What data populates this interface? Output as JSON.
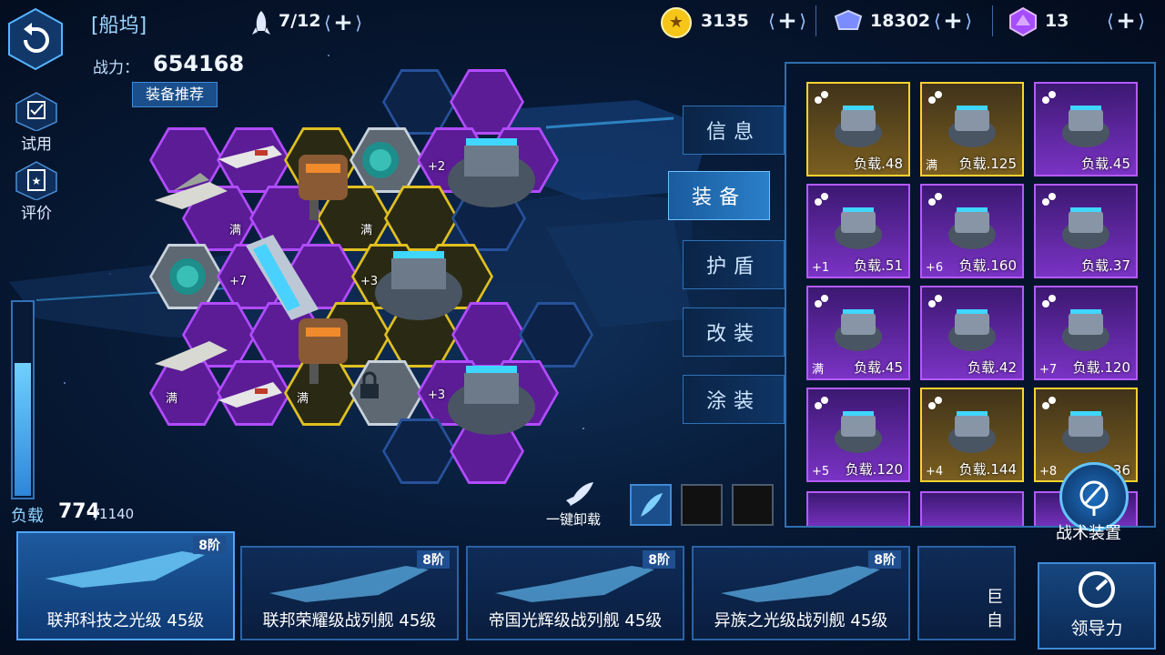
{
  "header": {
    "title": "[船坞]",
    "fleet_count": "7/12"
  },
  "resources": [
    {
      "name": "gold-coin-icon",
      "value": "3135",
      "color": "#f5c518"
    },
    {
      "name": "crystal-icon",
      "value": "18302",
      "color": "#6f82ff"
    },
    {
      "name": "gem-icon",
      "value": "13",
      "color": "#a64dff"
    }
  ],
  "power": {
    "label": "战力：",
    "value": "654168"
  },
  "recommend_button": "装备推荐",
  "side_buttons": {
    "trial": "试用",
    "review": "评价"
  },
  "load": {
    "label": "负载",
    "current": "774",
    "max": "/1140",
    "fraction": 0.68
  },
  "hex_labels": {
    "full1": "满",
    "full2": "满",
    "full3": "满",
    "full4": "满",
    "plus2": "+2",
    "plus3a": "+3",
    "plus7": "+7",
    "plus3b": "+3"
  },
  "tabs": [
    "信息",
    "装备",
    "护盾",
    "改装",
    "涂装"
  ],
  "active_tab": "装备",
  "inventory": [
    {
      "rarity": "y",
      "load": "负载.48",
      "tag": ""
    },
    {
      "rarity": "y",
      "load": "负载.125",
      "tag": "满"
    },
    {
      "rarity": "p",
      "load": "负载.45",
      "tag": ""
    },
    {
      "rarity": "p",
      "load": "负载.51",
      "tag": "+1"
    },
    {
      "rarity": "p",
      "load": "负载.160",
      "tag": "+6"
    },
    {
      "rarity": "p",
      "load": "负载.37",
      "tag": ""
    },
    {
      "rarity": "p",
      "load": "负载.45",
      "tag": "满"
    },
    {
      "rarity": "p",
      "load": "负载.42",
      "tag": ""
    },
    {
      "rarity": "p",
      "load": "负载.120",
      "tag": "+7"
    },
    {
      "rarity": "p",
      "load": "负载.120",
      "tag": "+5"
    },
    {
      "rarity": "y",
      "load": "负载.144",
      "tag": "+4"
    },
    {
      "rarity": "y",
      "load": "36",
      "tag": "+8"
    }
  ],
  "unload_all": "一键卸载",
  "tactical_device": "战术装置",
  "ships": [
    {
      "name": "联邦科技之光级 45级",
      "tier": "8阶"
    },
    {
      "name": "联邦荣耀级战列舰 45级",
      "tier": "8阶"
    },
    {
      "name": "帝国光辉级战列舰 45级",
      "tier": "8阶"
    },
    {
      "name": "异族之光级战列舰 45级",
      "tier": "8阶"
    },
    {
      "name": "巨自",
      "tier": ""
    }
  ],
  "navigator": "领导力"
}
